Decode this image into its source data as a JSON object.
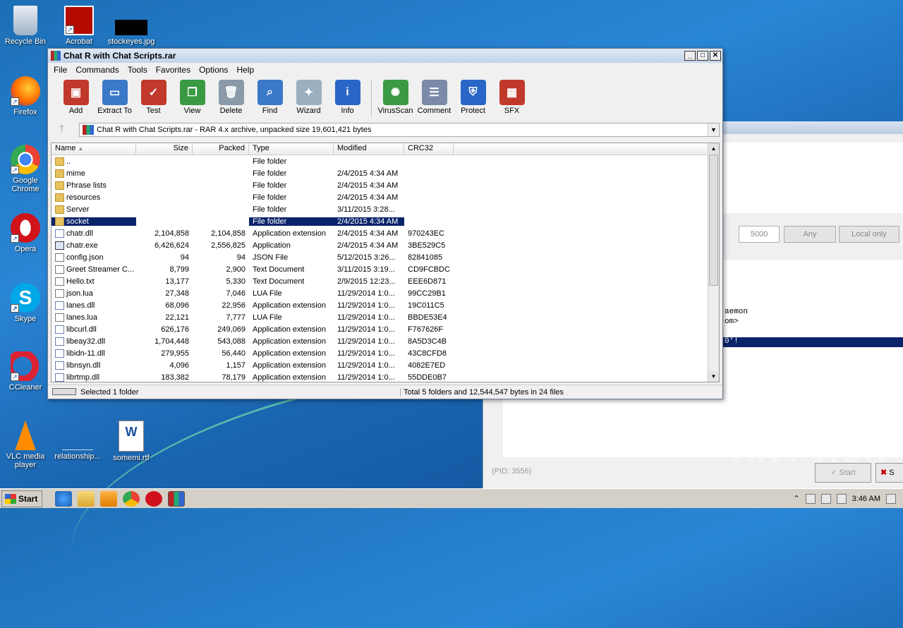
{
  "desktop": {
    "icons": [
      {
        "label": "Recycle Bin"
      },
      {
        "label": "Acrobat"
      },
      {
        "label": "stockeyes.jpg"
      },
      {
        "label": "Firefox"
      },
      {
        "label": "Google Chrome"
      },
      {
        "label": "Opera"
      },
      {
        "label": "Skype"
      },
      {
        "label": "CCleaner"
      },
      {
        "label": "VLC media player"
      },
      {
        "label": "relationship..."
      },
      {
        "label": "somemi.rtf"
      }
    ]
  },
  "background_window": {
    "port_value": "5000",
    "any_label": "Any",
    "local_only_label": "Local only",
    "console_lines": [
      "aemon",
      "om>",
      "0'!"
    ],
    "pid_text": "(PID: 3556)",
    "start_label": "Start",
    "stop_label": "S"
  },
  "winrar": {
    "title": "Chat R with Chat Scripts.rar",
    "menu": [
      "File",
      "Commands",
      "Tools",
      "Favorites",
      "Options",
      "Help"
    ],
    "toolbar": [
      {
        "label": "Add",
        "icon": "add-icon",
        "color": "#c0392b"
      },
      {
        "label": "Extract To",
        "icon": "extract-folder-icon",
        "color": "#3a78c8"
      },
      {
        "label": "Test",
        "icon": "test-clipboard-icon",
        "color": "#c0392b"
      },
      {
        "label": "View",
        "icon": "view-book-icon",
        "color": "#3a9a44"
      },
      {
        "label": "Delete",
        "icon": "trash-icon",
        "color": "#8a9aa8"
      },
      {
        "label": "Find",
        "icon": "magnifier-icon",
        "color": "#3a78c8"
      },
      {
        "label": "Wizard",
        "icon": "wand-icon",
        "color": "#9ab0c0"
      },
      {
        "label": "Info",
        "icon": "info-icon",
        "color": "#2a66c8"
      },
      {
        "label": "VirusScan",
        "icon": "bug-icon",
        "color": "#3a9a44"
      },
      {
        "label": "Comment",
        "icon": "comment-icon",
        "color": "#7a8aa8"
      },
      {
        "label": "Protect",
        "icon": "shield-icon",
        "color": "#2a66c8"
      },
      {
        "label": "SFX",
        "icon": "sfx-box-icon",
        "color": "#c0392b"
      }
    ],
    "address": "Chat R with Chat Scripts.rar - RAR 4.x archive, unpacked size 19,601,421 bytes",
    "columns": {
      "name": "Name",
      "size": "Size",
      "packed": "Packed",
      "type": "Type",
      "modified": "Modified",
      "crc": "CRC32"
    },
    "rows": [
      {
        "name": "..",
        "size": "",
        "packed": "",
        "type": "File folder",
        "modified": "",
        "crc": "",
        "kind": "folder"
      },
      {
        "name": "mime",
        "size": "",
        "packed": "",
        "type": "File folder",
        "modified": "2/4/2015 4:34 AM",
        "crc": "",
        "kind": "folder"
      },
      {
        "name": "Phrase lists",
        "size": "",
        "packed": "",
        "type": "File folder",
        "modified": "2/4/2015 4:34 AM",
        "crc": "",
        "kind": "folder"
      },
      {
        "name": "resources",
        "size": "",
        "packed": "",
        "type": "File folder",
        "modified": "2/4/2015 4:34 AM",
        "crc": "",
        "kind": "folder"
      },
      {
        "name": "Server",
        "size": "",
        "packed": "",
        "type": "File folder",
        "modified": "3/11/2015 3:28...",
        "crc": "",
        "kind": "folder"
      },
      {
        "name": "socket",
        "size": "",
        "packed": "",
        "type": "File folder",
        "modified": "2/4/2015 4:34 AM",
        "crc": "",
        "kind": "folder",
        "selected": true
      },
      {
        "name": "chatr.dll",
        "size": "2,104,858",
        "packed": "2,104,858",
        "type": "Application extension",
        "modified": "2/4/2015 4:34 AM",
        "crc": "970243EC",
        "kind": "dll"
      },
      {
        "name": "chatr.exe",
        "size": "6,426,624",
        "packed": "2,556,825",
        "type": "Application",
        "modified": "2/4/2015 4:34 AM",
        "crc": "3BE529C5",
        "kind": "exe"
      },
      {
        "name": "config.json",
        "size": "94",
        "packed": "94",
        "type": "JSON File",
        "modified": "5/12/2015 3:26...",
        "crc": "82841085",
        "kind": "file"
      },
      {
        "name": "Greet Streamer C...",
        "size": "8,799",
        "packed": "2,900",
        "type": "Text Document",
        "modified": "3/11/2015 3:19...",
        "crc": "CD9FCBDC",
        "kind": "file"
      },
      {
        "name": "Hello.txt",
        "size": "13,177",
        "packed": "5,330",
        "type": "Text Document",
        "modified": "2/9/2015 12:23...",
        "crc": "EEE6D871",
        "kind": "file"
      },
      {
        "name": "json.lua",
        "size": "27,348",
        "packed": "7,046",
        "type": "LUA File",
        "modified": "11/29/2014 1:0...",
        "crc": "99CC29B1",
        "kind": "file"
      },
      {
        "name": "lanes.dll",
        "size": "68,096",
        "packed": "22,956",
        "type": "Application extension",
        "modified": "11/29/2014 1:0...",
        "crc": "19C011C5",
        "kind": "dll"
      },
      {
        "name": "lanes.lua",
        "size": "22,121",
        "packed": "7,777",
        "type": "LUA File",
        "modified": "11/29/2014 1:0...",
        "crc": "BBDE53E4",
        "kind": "file"
      },
      {
        "name": "libcurl.dll",
        "size": "626,176",
        "packed": "249,069",
        "type": "Application extension",
        "modified": "11/29/2014 1:0...",
        "crc": "F767626F",
        "kind": "dll"
      },
      {
        "name": "libeay32.dll",
        "size": "1,704,448",
        "packed": "543,088",
        "type": "Application extension",
        "modified": "11/29/2014 1:0...",
        "crc": "8A5D3C4B",
        "kind": "dll"
      },
      {
        "name": "libidn-11.dll",
        "size": "279,955",
        "packed": "56,440",
        "type": "Application extension",
        "modified": "11/29/2014 1:0...",
        "crc": "43C8CFD8",
        "kind": "dll"
      },
      {
        "name": "libnsyn.dll",
        "size": "4,096",
        "packed": "1,157",
        "type": "Application extension",
        "modified": "11/29/2014 1:0...",
        "crc": "4082E7ED",
        "kind": "dll"
      },
      {
        "name": "librtmp.dll",
        "size": "183,382",
        "packed": "78,179",
        "type": "Application extension",
        "modified": "11/29/2014 1:0...",
        "crc": "55DDE0B7",
        "kind": "dll"
      }
    ],
    "status_left": "Selected 1 folder",
    "status_right": "Total 5 folders and 12,544,547 bytes in 24 files"
  },
  "watermark": "ANY RUN",
  "taskbar": {
    "start_label": "Start",
    "clock": "3:46 AM"
  }
}
